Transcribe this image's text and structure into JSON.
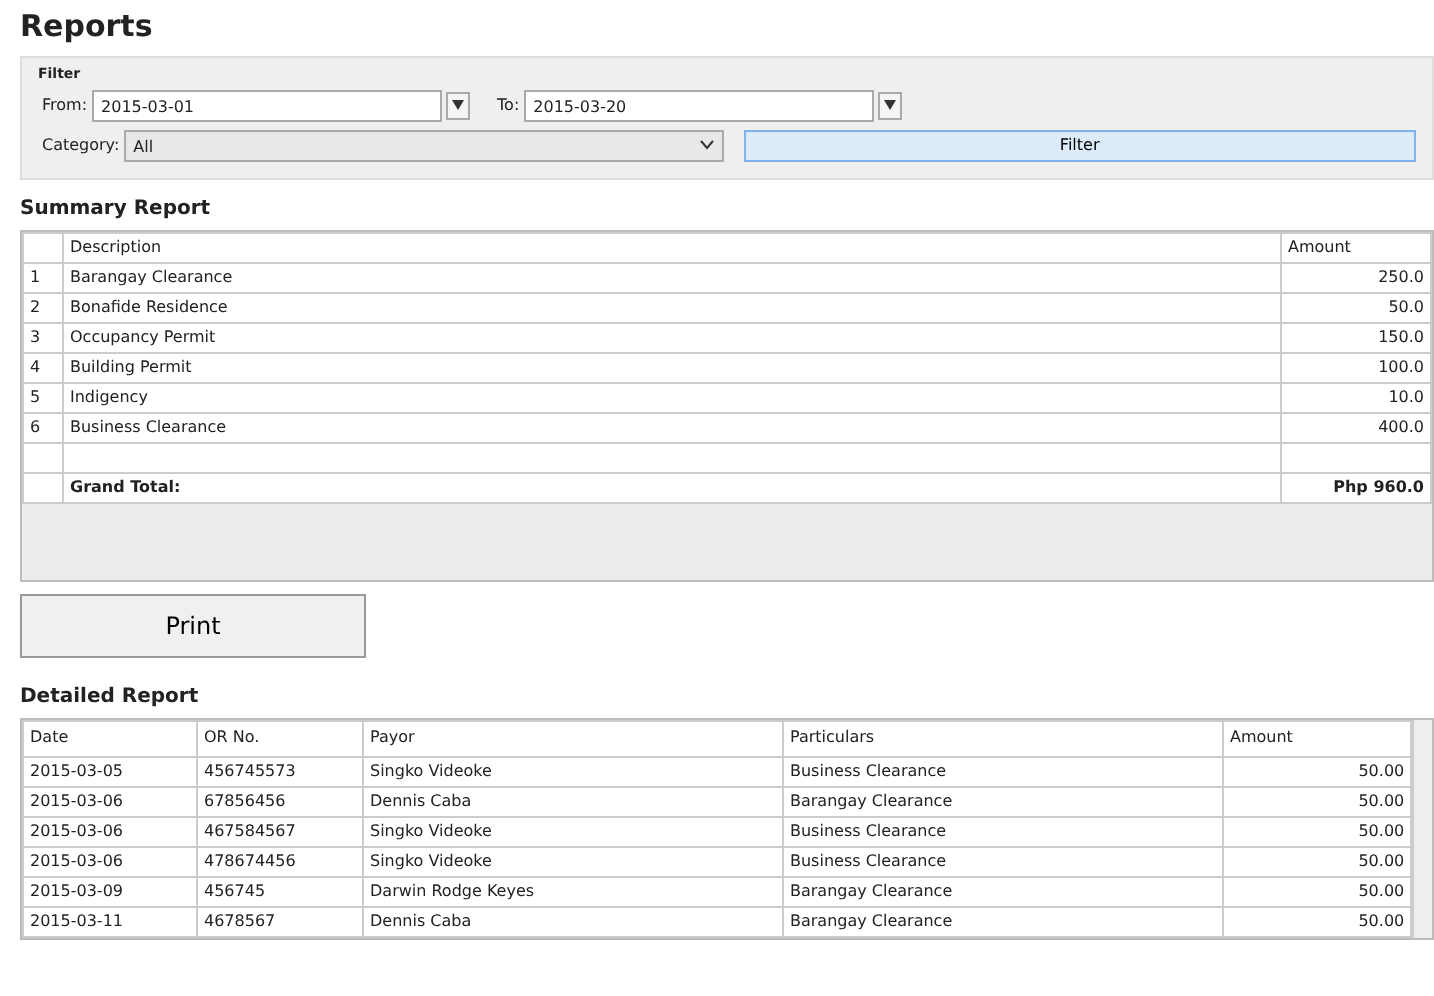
{
  "title": "Reports",
  "filter": {
    "legend": "Filter",
    "from_label": "From:",
    "from_value": "2015-03-01",
    "to_label": "To:",
    "to_value": "2015-03-20",
    "category_label": "Category:",
    "category_value": "All",
    "button": "Filter"
  },
  "summary": {
    "heading": "Summary Report",
    "columns": [
      "Description",
      "Amount"
    ],
    "rows": [
      {
        "no": "1",
        "description": "Barangay Clearance",
        "amount": "250.0"
      },
      {
        "no": "2",
        "description": "Bonafide Residence",
        "amount": "50.0"
      },
      {
        "no": "3",
        "description": "Occupancy Permit",
        "amount": "150.0"
      },
      {
        "no": "4",
        "description": "Building Permit",
        "amount": "100.0"
      },
      {
        "no": "5",
        "description": "Indigency",
        "amount": "10.0"
      },
      {
        "no": "6",
        "description": "Business Clearance",
        "amount": "400.0"
      }
    ],
    "total_label": "Grand Total:",
    "total_value": "Php 960.0"
  },
  "print_button": "Print",
  "detailed": {
    "heading": "Detailed Report",
    "columns": [
      "Date",
      "OR No.",
      "Payor",
      "Particulars",
      "Amount"
    ],
    "rows": [
      [
        "2015-03-05",
        "456745573",
        "Singko Videoke",
        "Business Clearance",
        "50.00"
      ],
      [
        "2015-03-06",
        "67856456",
        "Dennis Caba",
        "Barangay Clearance",
        "50.00"
      ],
      [
        "2015-03-06",
        "467584567",
        "Singko Videoke",
        "Business Clearance",
        "50.00"
      ],
      [
        "2015-03-06",
        "478674456",
        "Singko Videoke",
        "Business Clearance",
        "50.00"
      ],
      [
        "2015-03-09",
        "456745",
        "Darwin Rodge Keyes",
        "Barangay Clearance",
        "50.00"
      ],
      [
        "2015-03-11",
        "4678567",
        "Dennis Caba",
        "Barangay Clearance",
        "50.00"
      ]
    ]
  }
}
